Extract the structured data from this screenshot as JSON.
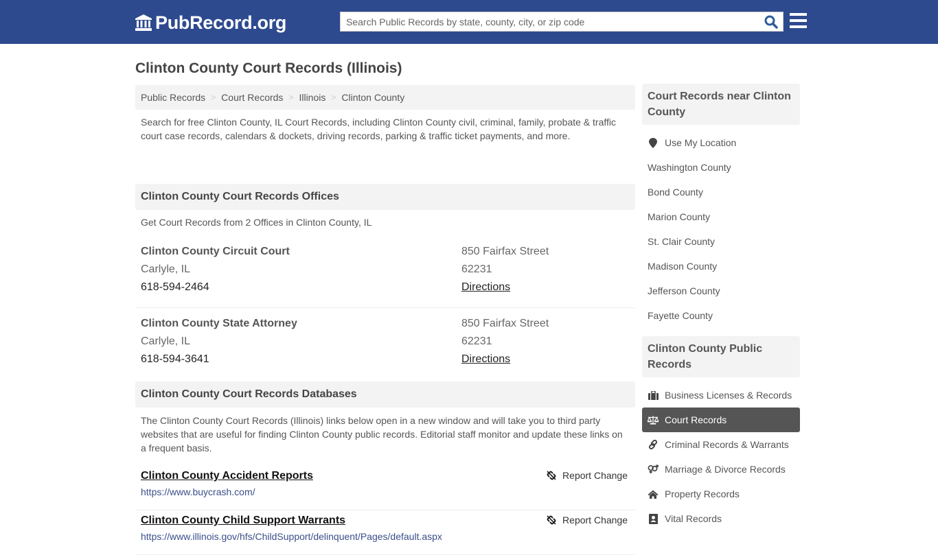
{
  "header": {
    "logo_text": "PubRecord.org",
    "search_placeholder": "Search Public Records by state, county, city, or zip code",
    "colors": {
      "brand": "#2e4a8f",
      "search_icon": "#2e5c9a"
    }
  },
  "page": {
    "title": "Clinton County Court Records (Illinois)"
  },
  "breadcrumb": [
    {
      "label": "Public Records"
    },
    {
      "label": "Court Records"
    },
    {
      "label": "Illinois"
    },
    {
      "label": "Clinton County"
    }
  ],
  "intro": "Search for free Clinton County, IL Court Records, including Clinton County civil, criminal, family, probate & traffic court case records, calendars & dockets, driving records, parking & traffic ticket payments, and more.",
  "offices": {
    "heading": "Clinton County Court Records Offices",
    "subheading": "Get Court Records from 2 Offices in Clinton County, IL",
    "items": [
      {
        "name": "Clinton County Circuit Court",
        "city": "Carlyle, IL",
        "phone": "618-594-2464",
        "address": "850 Fairfax Street",
        "zip": "62231",
        "directions": "Directions"
      },
      {
        "name": "Clinton County State Attorney",
        "city": "Carlyle, IL",
        "phone": "618-594-3641",
        "address": "850 Fairfax Street",
        "zip": "62231",
        "directions": "Directions"
      }
    ]
  },
  "databases": {
    "heading": "Clinton County Court Records Databases",
    "intro": "The Clinton County Court Records (Illinois) links below open in a new window and will take you to third party websites that are useful for finding Clinton County public records. Editorial staff monitor and update these links on a frequent basis.",
    "items": [
      {
        "title": "Clinton County Accident Reports",
        "url": "https://www.buycrash.com/",
        "report_label": "Report Change"
      },
      {
        "title": "Clinton County Child Support Warrants",
        "url": "https://www.illinois.gov/hfs/ChildSupport/delinquent/Pages/default.aspx",
        "report_label": "Report Change"
      }
    ]
  },
  "sidebar": {
    "nearby": {
      "heading": "Court Records near Clinton County",
      "use_location": "Use My Location",
      "items": [
        {
          "label": "Washington County"
        },
        {
          "label": "Bond County"
        },
        {
          "label": "Marion County"
        },
        {
          "label": "St. Clair County"
        },
        {
          "label": "Madison County"
        },
        {
          "label": "Jefferson County"
        },
        {
          "label": "Fayette County"
        }
      ]
    },
    "public_records": {
      "heading": "Clinton County Public Records",
      "items": [
        {
          "label": "Business Licenses & Records",
          "icon": "briefcase-icon",
          "active": false
        },
        {
          "label": "Court Records",
          "icon": "scales-icon",
          "active": true
        },
        {
          "label": "Criminal Records & Warrants",
          "icon": "link-icon",
          "active": false
        },
        {
          "label": "Marriage & Divorce Records",
          "icon": "gender-icon",
          "active": false
        },
        {
          "label": "Property Records",
          "icon": "home-icon",
          "active": false
        },
        {
          "label": "Vital Records",
          "icon": "id-card-icon",
          "active": false
        }
      ]
    }
  }
}
